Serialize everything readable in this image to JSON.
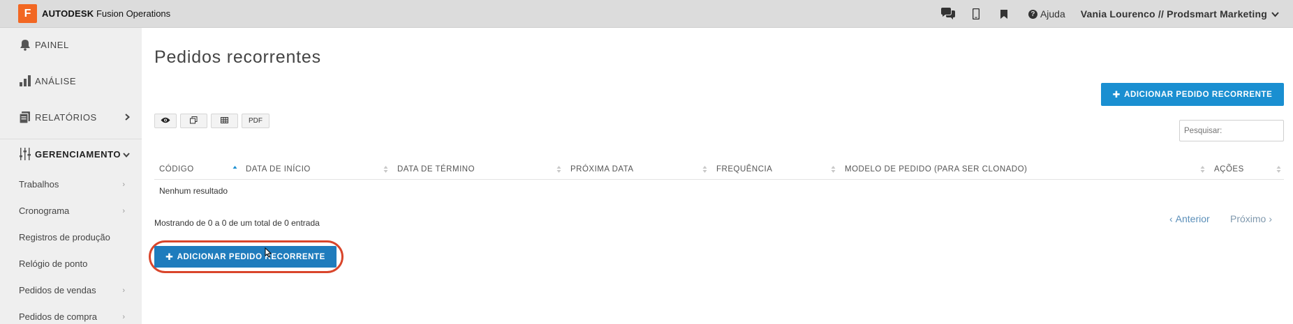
{
  "app": {
    "logo_letter": "F",
    "brand": "AUTODESK",
    "product": "Fusion Operations",
    "brand_color": "#f26722"
  },
  "topbar": {
    "icons": [
      "chat-icon",
      "mobile-phone-icon",
      "bookmark-icon"
    ],
    "help_label": "Ajuda",
    "user_label": "Vania Lourenco // Prodsmart Marketing"
  },
  "sidebar": {
    "items": [
      {
        "label": "PAINEL",
        "icon": "bell-icon"
      },
      {
        "label": "ANÁLISE",
        "icon": "bar-chart-icon"
      },
      {
        "label": "RELATÓRIOS",
        "icon": "reports-icon"
      },
      {
        "label": "GERENCIAMENTO",
        "icon": "sliders-icon"
      }
    ],
    "sub_items": [
      {
        "label": "Trabalhos",
        "has_arrow": true
      },
      {
        "label": "Cronograma",
        "has_arrow": true
      },
      {
        "label": "Registros de produção",
        "has_arrow": false
      },
      {
        "label": "Relógio de ponto",
        "has_arrow": false
      },
      {
        "label": "Pedidos de vendas",
        "has_arrow": true
      },
      {
        "label": "Pedidos de compra",
        "has_arrow": true
      }
    ]
  },
  "main": {
    "title": "Pedidos recorrentes",
    "add_button_label": "ADICIONAR PEDIDO RECORRENTE",
    "toolbar": {
      "pdf_label": "PDF"
    },
    "search": {
      "placeholder": "Pesquisar:"
    },
    "table": {
      "columns": [
        "CÓDIGO",
        "DATA DE INÍCIO",
        "DATA DE TÉRMINO",
        "PRÓXIMA DATA",
        "FREQUÊNCIA",
        "MODELO DE PEDIDO (PARA SER CLONADO)",
        "AÇÕES"
      ],
      "empty_text": "Nenhum resultado"
    },
    "info_text": "Mostrando de 0 a 0 de um total de 0 entrada",
    "pager": {
      "prev": "Anterior",
      "next": "Próximo"
    },
    "accent_color": "#1a8fd1",
    "highlight_color": "#d9452b"
  }
}
